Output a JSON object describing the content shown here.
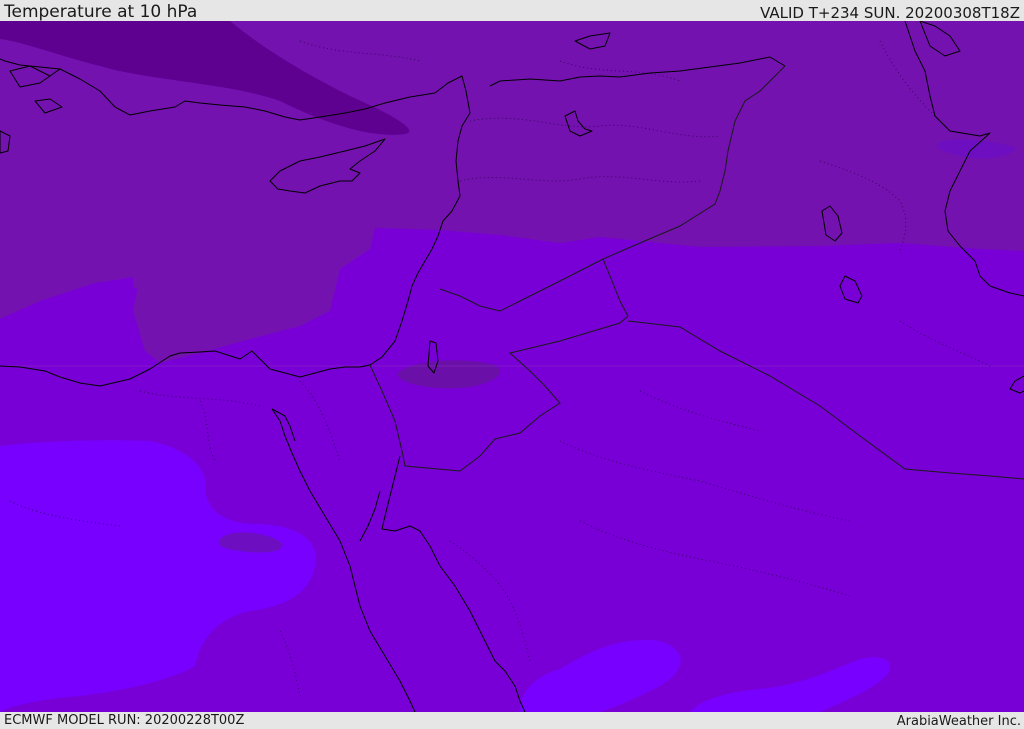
{
  "header": {
    "title": "Temperature at 10 hPa",
    "valid_time": "VALID T+234 SUN. 20200308T18Z"
  },
  "footer": {
    "model_run": "ECMWF MODEL RUN: 20200228T00Z",
    "credit": "ArabiaWeather Inc."
  },
  "map": {
    "colors": {
      "coldest": "#5e0090",
      "colder": "#7412b0",
      "mid": "#7800d6",
      "warmer": "#7700ff",
      "coastline": "#000000"
    }
  }
}
